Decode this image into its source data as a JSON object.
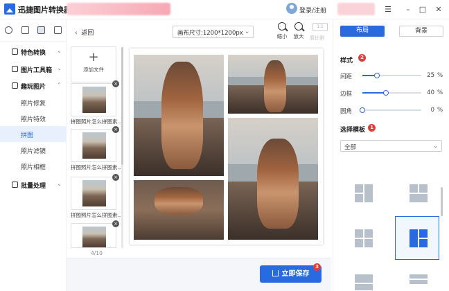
{
  "app": {
    "title": "迅捷图片转换器",
    "login_label": "登录/注册",
    "win_buttons": [
      "☰",
      "–",
      "□",
      "✕"
    ]
  },
  "nav": {
    "sections": [
      {
        "label": "特色转换",
        "expanded": false
      },
      {
        "label": "图片工具箱",
        "expanded": false
      },
      {
        "label": "趣玩图片",
        "expanded": true
      },
      {
        "label": "批量处理",
        "expanded": false
      }
    ],
    "sub_items": [
      {
        "label": "照片修复",
        "active": false
      },
      {
        "label": "照片特效",
        "active": false
      },
      {
        "label": "拼图",
        "active": true
      },
      {
        "label": "照片滤镜",
        "active": false
      },
      {
        "label": "照片相框",
        "active": false
      }
    ]
  },
  "toolbar": {
    "back_label": "返回",
    "canvas_size_label": "画布尺寸:1200*1200px",
    "zoom_out_label": "缩小",
    "zoom_in_label": "放大",
    "ratio_value": "1:1",
    "ratio_label": "原比例"
  },
  "thumbnails": {
    "add_label": "添加文件",
    "items": [
      {
        "caption": "拼图照片怎么拼图素..."
      },
      {
        "caption": "拼图照片怎么拼图素..."
      },
      {
        "caption": "拼图照片怎么拼图素..."
      }
    ],
    "counter": "4/10"
  },
  "save": {
    "label": "立即保存",
    "badge": "3"
  },
  "right": {
    "tab_layout": "布局",
    "tab_background": "背景",
    "style_title": "样式",
    "style_badge": "2",
    "sliders": [
      {
        "label": "间距",
        "value": 25,
        "unit": "%"
      },
      {
        "label": "边框",
        "value": 40,
        "unit": "%"
      },
      {
        "label": "圆角",
        "value": 0,
        "unit": "%"
      }
    ],
    "template_title": "选择模板",
    "template_badge": "1",
    "template_filter": "全部"
  },
  "colors": {
    "accent": "#2a6ae0",
    "badge": "#e23b3b"
  }
}
